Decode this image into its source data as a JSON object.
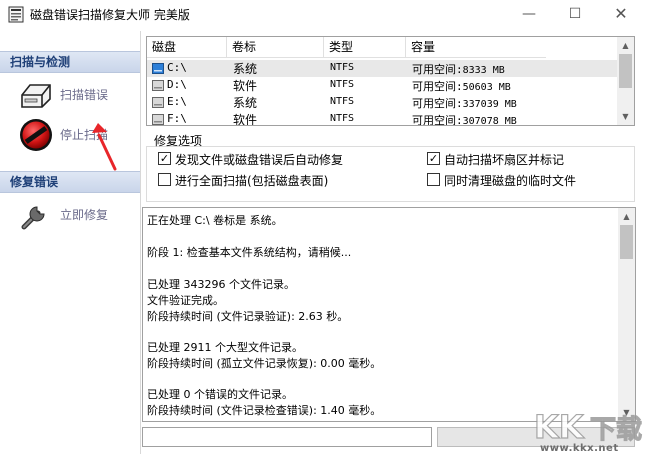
{
  "window": {
    "title": "磁盘错误扫描修复大师 完美版",
    "min_glyph": "—",
    "max_glyph": "☐",
    "close_glyph": "✕"
  },
  "sidebar": {
    "scan_section_label": "扫描与检测",
    "scan_items": [
      {
        "label": "扫描错误",
        "icon": "drive-icon"
      },
      {
        "label": "停止扫描",
        "icon": "stop-icon"
      }
    ],
    "repair_section_label": "修复错误",
    "repair_items": [
      {
        "label": "立即修复",
        "icon": "wrench-icon"
      }
    ]
  },
  "drives": {
    "columns": [
      "磁盘",
      "卷标",
      "类型",
      "容量"
    ],
    "rows": [
      {
        "name": "C:\\",
        "label": "系统",
        "fs": "NTFS",
        "cap_label": "可用空间:",
        "cap_value": "8333 MB",
        "selected": true
      },
      {
        "name": "D:\\",
        "label": "软件",
        "fs": "NTFS",
        "cap_label": "可用空间:",
        "cap_value": "50603 MB"
      },
      {
        "name": "E:\\",
        "label": "系统",
        "fs": "NTFS",
        "cap_label": "可用空间:",
        "cap_value": "337039 MB"
      },
      {
        "name": "F:\\",
        "label": "软件",
        "fs": "NTFS",
        "cap_label": "可用空间:",
        "cap_value": "307078 MB"
      }
    ]
  },
  "options": {
    "title": "修复选项",
    "items": [
      {
        "label": "发现文件或磁盘错误后自动修复",
        "checked": true
      },
      {
        "label": "进行全面扫描(包括磁盘表面)",
        "checked": false
      },
      {
        "label": "自动扫描坏扇区并标记",
        "checked": true
      },
      {
        "label": "同时清理磁盘的临时文件",
        "checked": false
      }
    ]
  },
  "log": {
    "lines": [
      "正在处理 C:\\ 卷标是 系统。",
      "",
      "阶段 1: 检查基本文件系统结构，请稍候...",
      "",
      "  已处理 343296 个文件记录。",
      "文件验证完成。",
      " 阶段持续时间 (文件记录验证): 2.63 秒。",
      "",
      "  已处理 2911 个大型文件记录。",
      " 阶段持续时间 (孤立文件记录恢复): 0.00 毫秒。",
      "",
      "  已处理 0 个错误的文件记录。",
      " 阶段持续时间 (文件记录检查错误): 1.40 毫秒。"
    ]
  },
  "status": {
    "text": "",
    "progress": 0
  },
  "watermark": {
    "logo": "KK下载",
    "url": "www.kkx.net"
  },
  "colors": {
    "section_header_text": "#1e3f77",
    "sidebar_label": "#6a6a8a",
    "arrow": "#e8262a"
  }
}
